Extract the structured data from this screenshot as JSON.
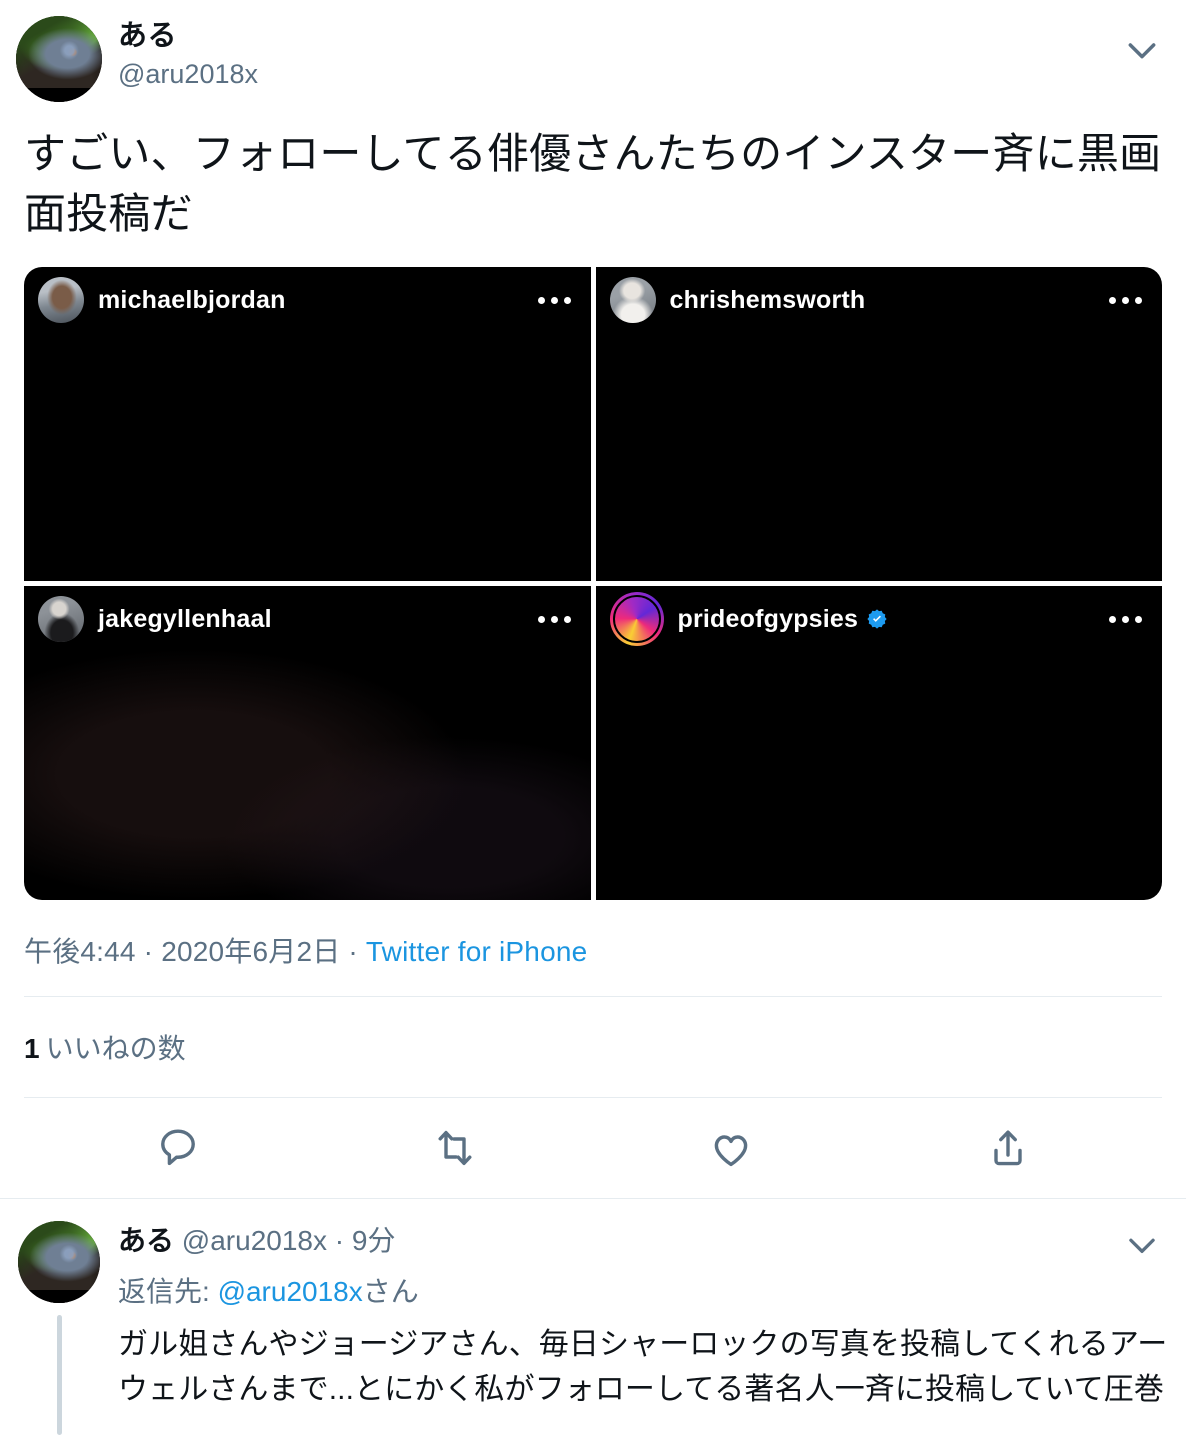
{
  "tweet": {
    "author": {
      "display_name": "ある",
      "handle": "@aru2018x",
      "avatar_icon": "user-avatar-insect-photo"
    },
    "more_icon": "chevron-down-icon",
    "text": "すごい、フォローしてる俳優さんたちのインスター斉に黒画面投稿だ",
    "media": {
      "cards": [
        {
          "username": "michaelbjordan",
          "verified": false,
          "has_story_ring": false,
          "menu_icon": "more-horizontal-icon",
          "avatar_icon": "instagram-avatar"
        },
        {
          "username": "chrishemsworth",
          "verified": false,
          "has_story_ring": false,
          "menu_icon": "more-horizontal-icon",
          "avatar_icon": "instagram-avatar"
        },
        {
          "username": "jakegyllenhaal",
          "verified": false,
          "has_story_ring": false,
          "menu_icon": "more-horizontal-icon",
          "avatar_icon": "instagram-avatar"
        },
        {
          "username": "prideofgypsies",
          "verified": true,
          "has_story_ring": true,
          "menu_icon": "more-horizontal-icon",
          "avatar_icon": "instagram-avatar"
        }
      ]
    },
    "meta": {
      "time": "午後4:44",
      "sep1": " · ",
      "date": "2020年6月2日",
      "sep2": " · ",
      "source": "Twitter for iPhone"
    },
    "stats": {
      "like_count": "1",
      "like_label": "いいねの数"
    },
    "actions": [
      {
        "name": "reply",
        "icon": "reply-icon"
      },
      {
        "name": "retweet",
        "icon": "retweet-icon"
      },
      {
        "name": "like",
        "icon": "heart-icon"
      },
      {
        "name": "share",
        "icon": "share-icon"
      }
    ]
  },
  "reply": {
    "display_name": "ある",
    "handle": "@aru2018x",
    "time_sep": " · ",
    "timestamp": "9分",
    "reply_to_label": "返信先: ",
    "reply_to_mention": "@aru2018x",
    "reply_to_suffix": "さん",
    "text": "ガル姐さんやジョージアさん、毎日シャーロックの写真を投稿してくれるアーウェルさんまで...とにかく私がフォローしてる著名人一斉に投稿していて圧巻",
    "more_icon": "chevron-down-icon",
    "avatar_icon": "user-avatar-insect-photo"
  },
  "colors": {
    "link": "#1b95e0",
    "muted": "#5b7083",
    "text": "#0f1419",
    "divider": "#e6ecf0",
    "thread_line": "#ccd6dd",
    "verified_blue": "#1d9bf0",
    "media_bg": "#000000"
  }
}
